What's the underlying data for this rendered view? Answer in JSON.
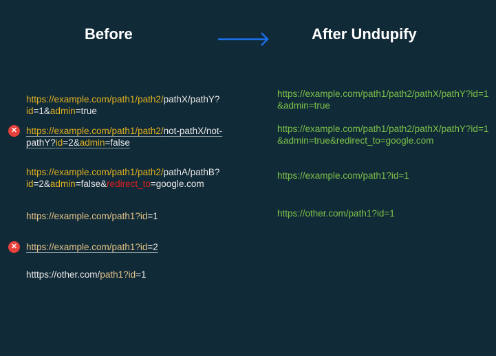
{
  "header": {
    "before": "Before",
    "after": "After Undupify",
    "arrow_color": "#1a6ee8"
  },
  "before": [
    {
      "duplicate": false,
      "segments": [
        [
          "y",
          "https://example.com/path1/path2/"
        ],
        [
          "w",
          "pathX/pathY?"
        ],
        [
          "y",
          "id"
        ],
        [
          "w",
          "=1&"
        ],
        [
          "y",
          "admin"
        ],
        [
          "w",
          "=true"
        ]
      ]
    },
    {
      "duplicate": true,
      "segments": [
        [
          "y",
          "https://example.com/path1/path2/"
        ],
        [
          "w",
          "not-pathX/not-pathY?"
        ],
        [
          "y",
          "id"
        ],
        [
          "w",
          "=2&"
        ],
        [
          "y",
          "admin"
        ],
        [
          "w",
          "=false"
        ]
      ]
    },
    {
      "duplicate": false,
      "segments": [
        [
          "y",
          "https://example.com/path1/path2/"
        ],
        [
          "w",
          "pathA/pathB?"
        ],
        [
          "y",
          "id"
        ],
        [
          "w",
          "=2&"
        ],
        [
          "y",
          "admin"
        ],
        [
          "w",
          "=false&"
        ],
        [
          "r",
          "redirect_to"
        ],
        [
          "w",
          "=google.com"
        ]
      ]
    },
    {
      "duplicate": false,
      "segments": [
        [
          "t",
          "https://example.com/path1?id"
        ],
        [
          "w",
          "=1"
        ]
      ]
    },
    {
      "duplicate": true,
      "segments": [
        [
          "t",
          "https://example.com/path1?id"
        ],
        [
          "w",
          "=2"
        ]
      ]
    },
    {
      "duplicate": false,
      "segments": [
        [
          "w",
          "htttps://other.com/"
        ],
        [
          "t",
          "path1?id"
        ],
        [
          "w",
          "=1"
        ]
      ]
    }
  ],
  "after": [
    "https://example.com/path1/path2/pathX/pathY?id=1&admin=true",
    "https://example.com/path1/path2/pathX/pathY?id=1&admin=true&redirect_to=google.com",
    "https://example.com/path1?id=1",
    "https://other.com/path1?id=1"
  ],
  "colors": {
    "background": "#112a37",
    "after_text": "#7cc24a",
    "highlight": "#e0b020",
    "removed_param": "#e02020",
    "duplicate_marker": "#e8403a"
  },
  "duplicate_icon": "close-icon"
}
